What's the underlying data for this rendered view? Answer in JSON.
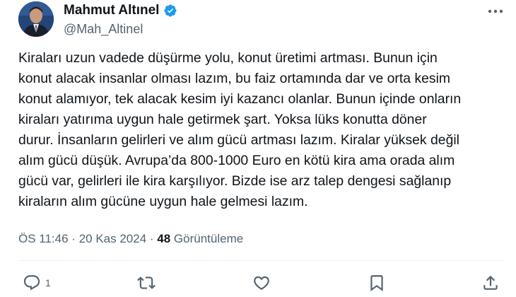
{
  "author": {
    "name": "Mahmut Altınel",
    "handle": "@Mah_Altinel"
  },
  "tweet": {
    "lines": [
      "Kiraları uzun vadede düşürme yolu, konut üretimi artması. Bunun için",
      "konut alacak insanlar olması lazım, bu faiz ortamında dar ve orta kesim",
      "konut alamıyor, tek alacak kesim iyi kazancı olanlar. Bunun içinde onların",
      "kiraları yatırıma uygun hale getirmek şart. Yoksa lüks konutta döner",
      "durur. İnsanların gelirleri ve alım gücü artması lazım. Kiralar yüksek değil",
      "alım gücü düşük. Avrupa’da 800-1000 Euro en kötü kira ama orada alım",
      "gücü var, gelirleri ile kira karşılıyor. Bizde ise arz talep dengesi sağlanıp",
      "kiraların alım gücüne uygun hale gelmesi lazım."
    ]
  },
  "meta": {
    "time": "ÖS 11:46",
    "separator": " · ",
    "date": "20 Kas 2024",
    "views_count": "48",
    "views_label": "Görüntüleme"
  },
  "actions": {
    "reply_count": "1"
  },
  "colors": {
    "verified": "#1d9bf0",
    "secondary_text": "#536471",
    "primary_text": "#0f1419"
  }
}
